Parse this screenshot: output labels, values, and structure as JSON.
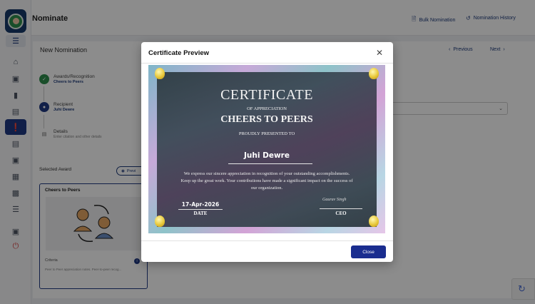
{
  "header": {
    "title": "Nominate",
    "bulk_label": "Bulk Nomination",
    "history_label": "Nomination History"
  },
  "section": {
    "title": "New Nomination",
    "prev_label": "Previous",
    "next_label": "Next"
  },
  "steps": [
    {
      "label": "Awards/Recognition",
      "value": "Cheers to Peers"
    },
    {
      "label": "Recipient",
      "value": "Juhi Dewre"
    },
    {
      "label": "Details",
      "hint": "Enter citation and other details"
    }
  ],
  "award": {
    "section_label": "Selected Award",
    "preview_label": "Previ",
    "title": "Cheers to Peers",
    "criteria_label": "Criteria",
    "criteria_text": "Peer to Peer appreciation notes. Peer-to-peer recog..."
  },
  "modal": {
    "title": "Certificate Preview",
    "close_label": "Close",
    "certificate": {
      "heading": "CERTIFICATE",
      "subheading": "OF APPRECIATION",
      "award": "CHEERS TO PEERS",
      "presented": "PROUDLY PRESENTED TO",
      "recipient": "Juhi Dewre",
      "body": "We express our sincere appreciation in recognition of your outstanding accomplishments. Keep up the great work. Your contributions have made a significant impact on the success of our organization.",
      "date": "17-Apr-2026",
      "date_label": "DATE",
      "signature": "Gaurav Singh",
      "ceo_label": "CEO"
    }
  },
  "colors": {
    "primary": "#1a2d8f",
    "accent_green": "#2f8f4e",
    "danger": "#d94444"
  }
}
